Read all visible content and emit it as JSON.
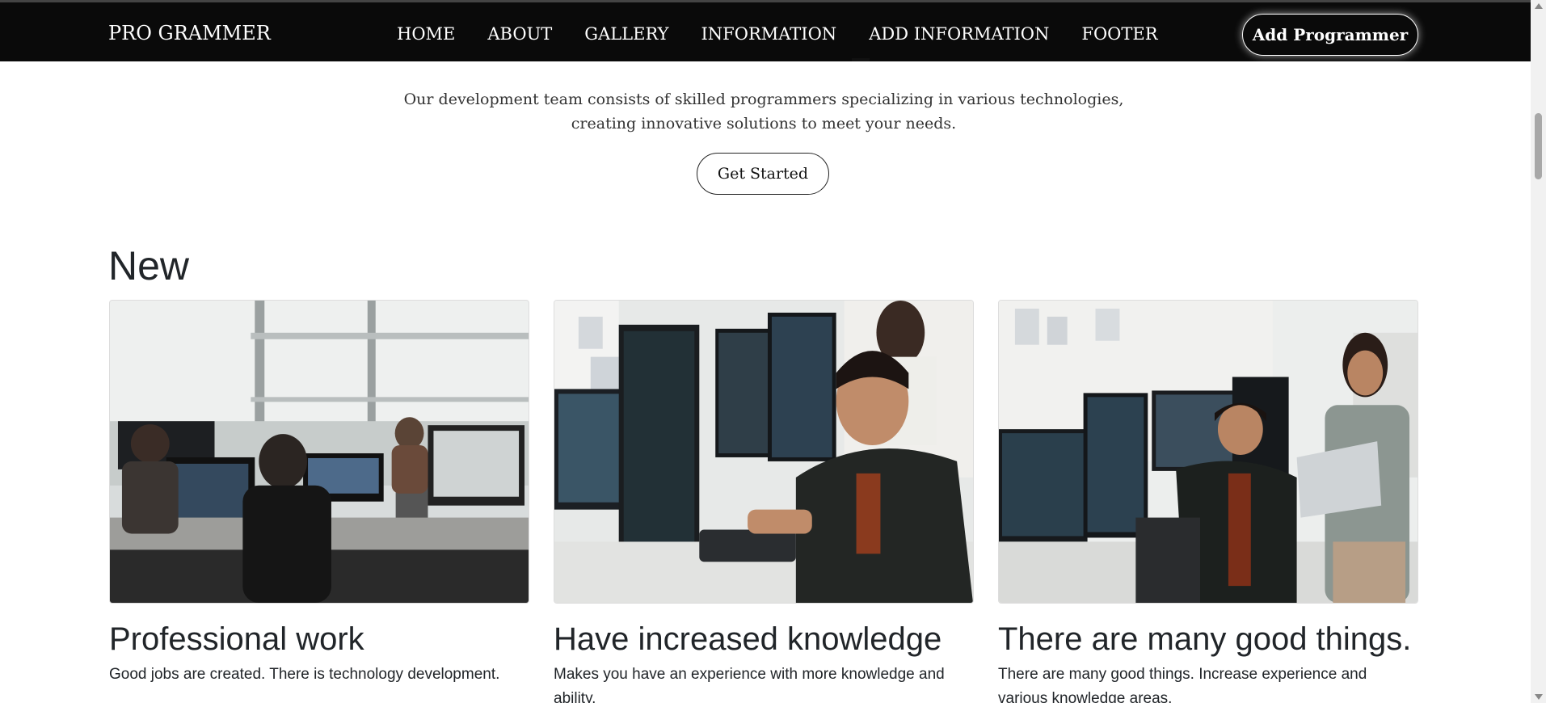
{
  "navbar": {
    "brand": "PRO GRAMMER",
    "links": [
      "HOME",
      "ABOUT",
      "GALLERY",
      "INFORMATION",
      "ADD INFORMATION",
      "FOOTER"
    ],
    "cta_label": "Add Programmer"
  },
  "hero": {
    "description_line1": "Our development team consists of skilled programmers specializing in various technologies,",
    "description_line2": "creating innovative solutions to meet your needs.",
    "button_label": "Get Started"
  },
  "section": {
    "title": "New",
    "cards": [
      {
        "image_icon": "office-programmers-photo",
        "title": "Professional work",
        "text": "Good jobs are created. There is technology development."
      },
      {
        "image_icon": "developer-coding-photo",
        "title": "Have increased knowledge",
        "text": "Makes you have an experience with more knowledge and ability."
      },
      {
        "image_icon": "team-laptop-photo",
        "title": "There are many good things.",
        "text": "There are many good things. Increase experience and various knowledge areas."
      }
    ]
  },
  "colors": {
    "navbar_bg": "#0a0a0a",
    "text": "#212529",
    "white": "#ffffff"
  }
}
